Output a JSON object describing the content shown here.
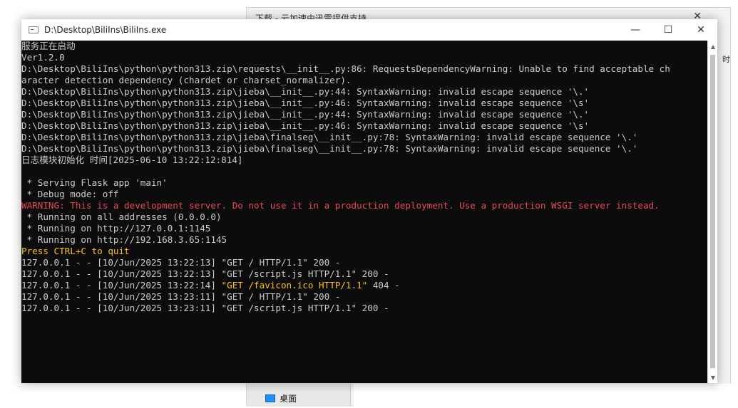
{
  "background_window": {
    "title": "下载 - 云加速由迅雷提供支持",
    "edge_text": "时",
    "footer_item": "桌面"
  },
  "window": {
    "title": "D:\\Desktop\\BiliIns\\BiliIns.exe",
    "minimize_glyph": "—",
    "maximize_glyph": "☐",
    "close_glyph": "✕"
  },
  "console": {
    "lines": [
      {
        "text": "服务正在启动",
        "color": "default"
      },
      {
        "text": "Ver1.2.0",
        "color": "default"
      },
      {
        "text": "D:\\Desktop\\BiliIns\\python\\python313.zip\\requests\\__init__.py:86: RequestsDependencyWarning: Unable to find acceptable ch",
        "color": "default"
      },
      {
        "text": "aracter detection dependency (chardet or charset_normalizer).",
        "color": "default"
      },
      {
        "text": "D:\\Desktop\\BiliIns\\python\\python313.zip\\jieba\\__init__.py:44: SyntaxWarning: invalid escape sequence '\\.'",
        "color": "default"
      },
      {
        "text": "D:\\Desktop\\BiliIns\\python\\python313.zip\\jieba\\__init__.py:46: SyntaxWarning: invalid escape sequence '\\s'",
        "color": "default"
      },
      {
        "text": "D:\\Desktop\\BiliIns\\python\\python313.zip\\jieba\\__init__.py:44: SyntaxWarning: invalid escape sequence '\\.'",
        "color": "default"
      },
      {
        "text": "D:\\Desktop\\BiliIns\\python\\python313.zip\\jieba\\__init__.py:46: SyntaxWarning: invalid escape sequence '\\s'",
        "color": "default"
      },
      {
        "text": "D:\\Desktop\\BiliIns\\python\\python313.zip\\jieba\\finalseg\\__init__.py:78: SyntaxWarning: invalid escape sequence '\\.'",
        "color": "default"
      },
      {
        "text": "D:\\Desktop\\BiliIns\\python\\python313.zip\\jieba\\finalseg\\__init__.py:78: SyntaxWarning: invalid escape sequence '\\.'",
        "color": "default"
      },
      {
        "text": "日志模块初始化 时间[2025-06-10 13:22:12:814]",
        "color": "default"
      },
      {
        "text": "",
        "color": "default"
      },
      {
        "text": " * Serving Flask app 'main'",
        "color": "default"
      },
      {
        "text": " * Debug mode: off",
        "color": "default"
      },
      {
        "text": "WARNING: This is a development server. Do not use it in a production deployment. Use a production WSGI server instead.",
        "color": "red"
      },
      {
        "text": " * Running on all addresses (0.0.0.0)",
        "color": "default"
      },
      {
        "text": " * Running on http://127.0.0.1:1145",
        "color": "default"
      },
      {
        "text": " * Running on http://192.168.3.65:1145",
        "color": "default"
      },
      {
        "text": "Press CTRL+C to quit",
        "color": "yellow"
      },
      {
        "text": "127.0.0.1 - - [10/Jun/2025 13:22:13] \"GET / HTTP/1.1\" 200 -",
        "color": "default"
      },
      {
        "text": "127.0.0.1 - - [10/Jun/2025 13:22:13] \"GET /script.js HTTP/1.1\" 200 -",
        "color": "default"
      },
      {
        "segments": [
          {
            "text": "127.0.0.1 - - [10/Jun/2025 13:22:14] ",
            "color": "default"
          },
          {
            "text": "\"GET /favicon.ico HTTP/1.1\"",
            "color": "yellow"
          },
          {
            "text": " 404 -",
            "color": "default"
          }
        ]
      },
      {
        "text": "127.0.0.1 - - [10/Jun/2025 13:23:11] \"GET / HTTP/1.1\" 200 -",
        "color": "default"
      },
      {
        "text": "127.0.0.1 - - [10/Jun/2025 13:23:11] \"GET /script.js HTTP/1.1\" 200 -",
        "color": "default"
      }
    ]
  },
  "colors": {
    "default": "#cccccc",
    "red": "#e74856",
    "yellow": "#f9c21a",
    "console_bg": "#0c0c0c"
  },
  "scrollbar": {
    "up_glyph": "▲",
    "down_glyph": "▼"
  }
}
